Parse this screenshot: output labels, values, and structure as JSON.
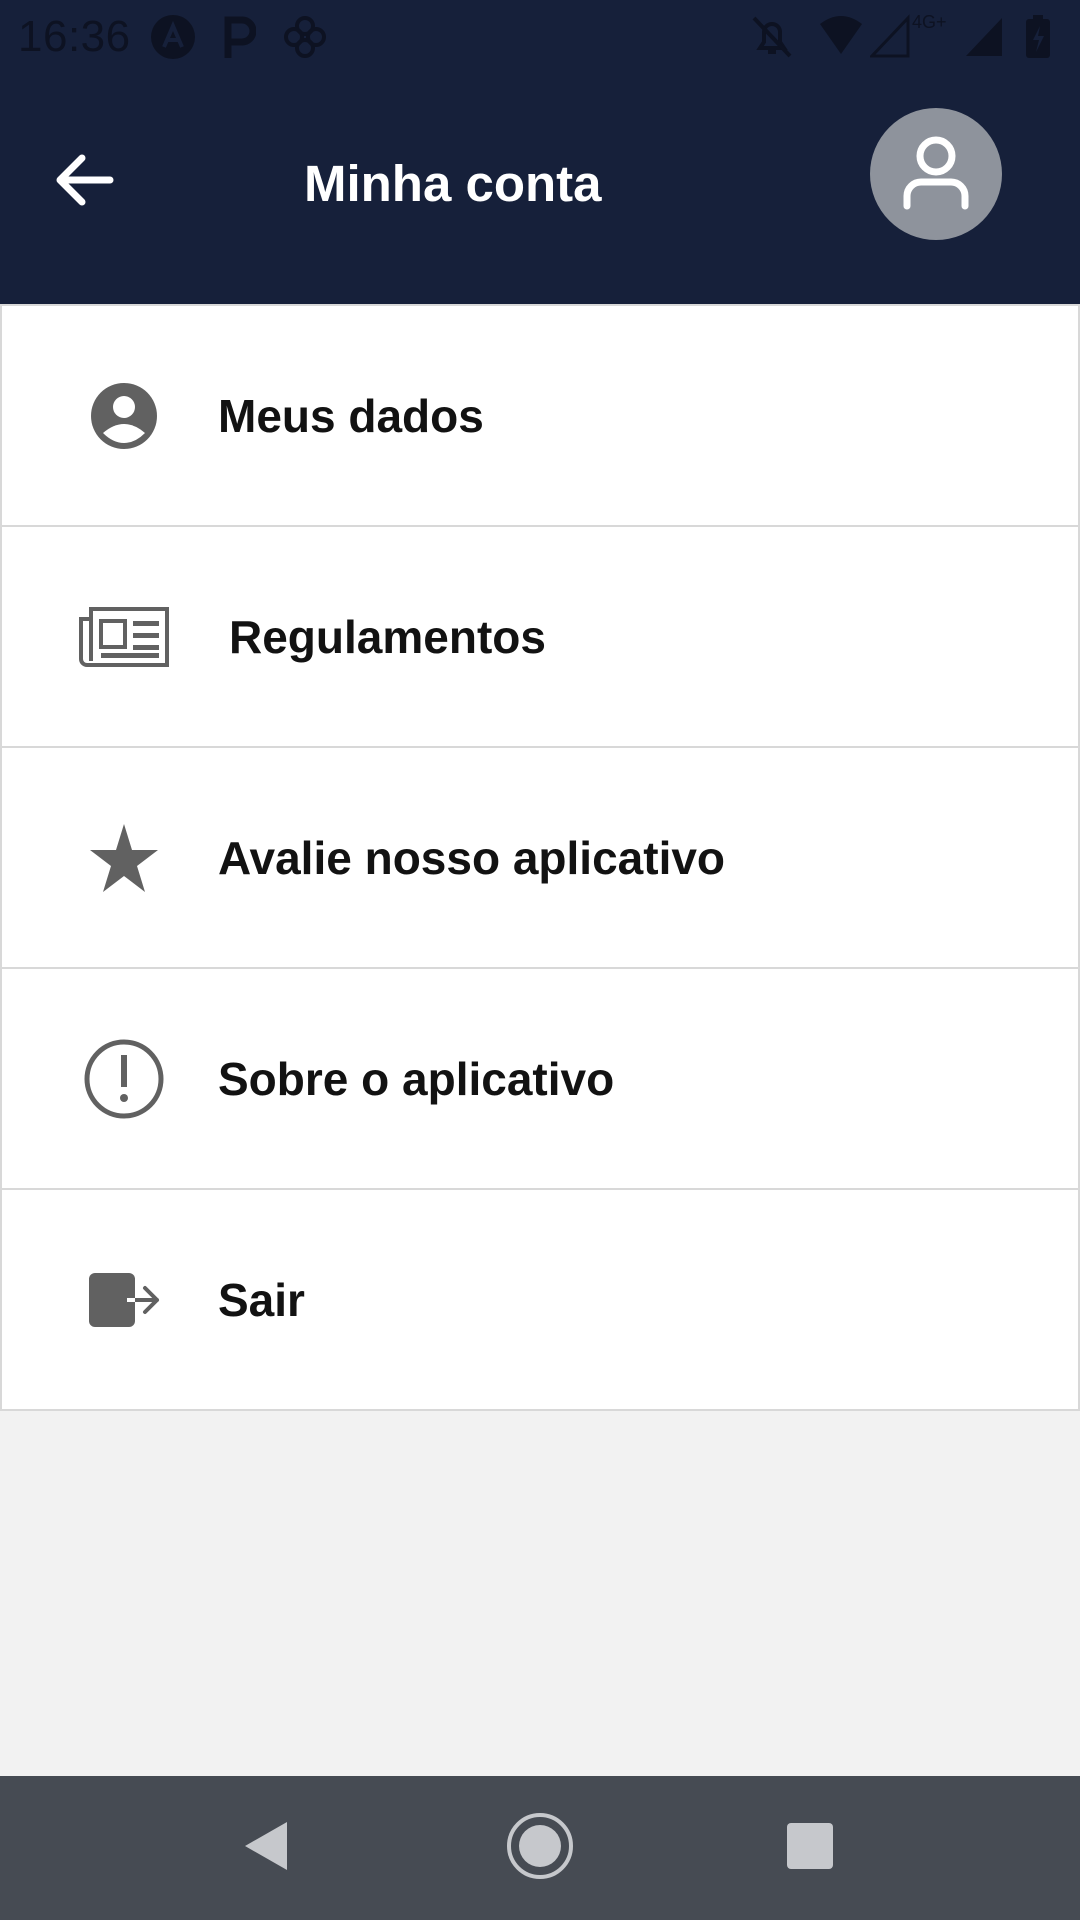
{
  "status_bar": {
    "time": "16:36",
    "network_label": "4G+"
  },
  "header": {
    "title": "Minha conta",
    "back_icon": "arrow-left-icon",
    "avatar_icon": "user-outline-icon"
  },
  "menu": {
    "items": [
      {
        "label": "Meus dados",
        "icon": "account-circle-icon"
      },
      {
        "label": "Regulamentos",
        "icon": "newspaper-icon"
      },
      {
        "label": "Avalie nosso aplicativo",
        "icon": "star-icon"
      },
      {
        "label": "Sobre o aplicativo",
        "icon": "info-exclamation-icon"
      },
      {
        "label": "Sair",
        "icon": "logout-icon"
      }
    ]
  },
  "nav_bar": {
    "back": "nav-back-icon",
    "home": "nav-home-icon",
    "recents": "nav-recents-icon"
  },
  "colors": {
    "header_bg": "#16203a",
    "page_bg": "#f2f2f2",
    "icon_gray": "#616161",
    "avatar_bg": "#8e939c",
    "nav_bg": "#464b53"
  }
}
